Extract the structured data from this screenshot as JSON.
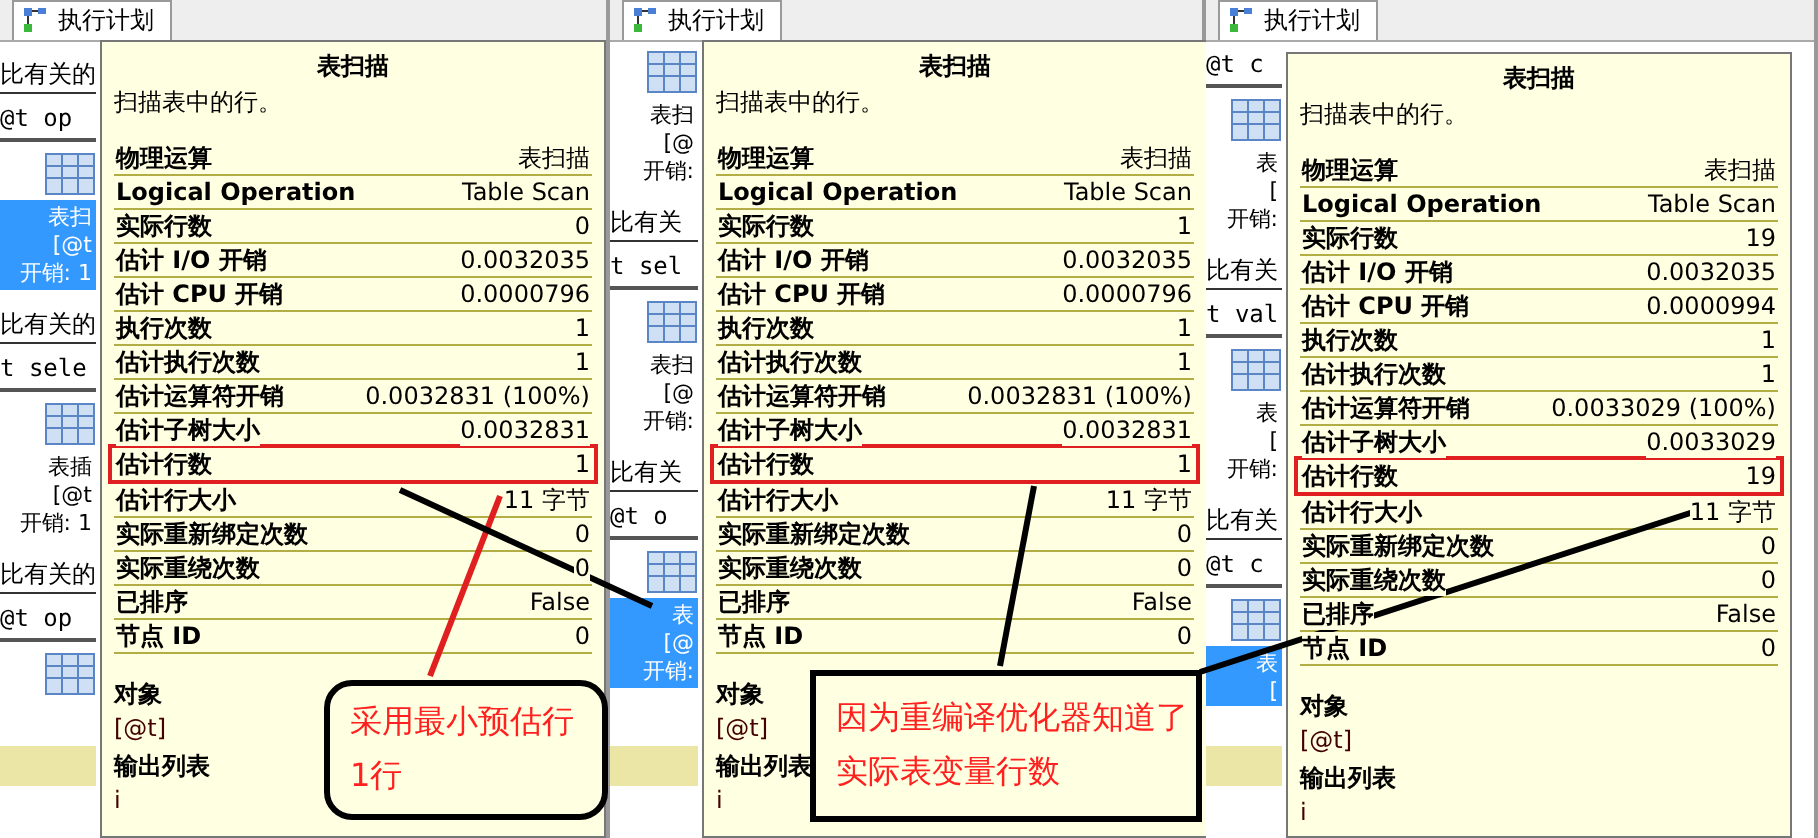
{
  "panels": [
    {
      "tab": "执行计划",
      "background": [
        {
          "kind": "text",
          "text": "比有关的"
        },
        {
          "kind": "code",
          "text": "@t op"
        },
        {
          "kind": "node",
          "selected": true,
          "lines": [
            "表扫",
            "[@t",
            "开销: 1"
          ]
        },
        {
          "kind": "text",
          "text": "比有关的"
        },
        {
          "kind": "code",
          "text": "t sele"
        },
        {
          "kind": "node",
          "selected": false,
          "lines": [
            "表插",
            "[@t",
            "开销: 1"
          ]
        },
        {
          "kind": "text",
          "text": "比有关的"
        },
        {
          "kind": "code",
          "text": "@t op"
        },
        {
          "kind": "node"
        },
        {
          "kind": "bar"
        }
      ],
      "tooltip": {
        "title": "表扫描",
        "description": "扫描表中的行。",
        "rows": [
          {
            "label": "物理运算",
            "value": "表扫描",
            "highlighted": false
          },
          {
            "label": "Logical Operation",
            "value": "Table Scan",
            "highlighted": false
          },
          {
            "label": "实际行数",
            "value": "0",
            "highlighted": false
          },
          {
            "label": "估计 I/O 开销",
            "value": "0.0032035",
            "highlighted": false
          },
          {
            "label": "估计 CPU 开销",
            "value": "0.0000796",
            "highlighted": false
          },
          {
            "label": "执行次数",
            "value": "1",
            "highlighted": false
          },
          {
            "label": "估计执行次数",
            "value": "1",
            "highlighted": false
          },
          {
            "label": "估计运算符开销",
            "value": "0.0032831 (100%)",
            "highlighted": false
          },
          {
            "label": "估计子树大小",
            "value": "0.0032831",
            "highlighted": false
          },
          {
            "label": "估计行数",
            "value": "1",
            "highlighted": true
          },
          {
            "label": "估计行大小",
            "value": "11 字节",
            "highlighted": false
          },
          {
            "label": "实际重新绑定次数",
            "value": "0",
            "highlighted": false
          },
          {
            "label": "实际重绕次数",
            "value": "0",
            "highlighted": false
          },
          {
            "label": "已排序",
            "value": "False",
            "highlighted": false
          },
          {
            "label": "节点 ID",
            "value": "0",
            "highlighted": false
          }
        ],
        "sections": [
          {
            "heading": "对象",
            "value": "[@t]"
          },
          {
            "heading": "输出列表",
            "value": "i"
          }
        ]
      }
    },
    {
      "tab": "执行计划",
      "background": [
        {
          "kind": "node",
          "selected": false,
          "lines": [
            "表扫",
            "[@",
            "开销:"
          ]
        },
        {
          "kind": "text",
          "text": "比有关"
        },
        {
          "kind": "code",
          "text": "t sel"
        },
        {
          "kind": "node",
          "selected": false,
          "lines": [
            "表扫",
            "[@",
            "开销:"
          ]
        },
        {
          "kind": "text",
          "text": "比有关"
        },
        {
          "kind": "code",
          "text": "@t o"
        },
        {
          "kind": "node",
          "selected": true,
          "lines": [
            "表",
            "[@",
            "开销:"
          ]
        },
        {
          "kind": "bar"
        }
      ],
      "tooltip": {
        "title": "表扫描",
        "description": "扫描表中的行。",
        "rows": [
          {
            "label": "物理运算",
            "value": "表扫描",
            "highlighted": false
          },
          {
            "label": "Logical Operation",
            "value": "Table Scan",
            "highlighted": false
          },
          {
            "label": "实际行数",
            "value": "1",
            "highlighted": false
          },
          {
            "label": "估计 I/O 开销",
            "value": "0.0032035",
            "highlighted": false
          },
          {
            "label": "估计 CPU 开销",
            "value": "0.0000796",
            "highlighted": false
          },
          {
            "label": "执行次数",
            "value": "1",
            "highlighted": false
          },
          {
            "label": "估计执行次数",
            "value": "1",
            "highlighted": false
          },
          {
            "label": "估计运算符开销",
            "value": "0.0032831 (100%)",
            "highlighted": false
          },
          {
            "label": "估计子树大小",
            "value": "0.0032831",
            "highlighted": false
          },
          {
            "label": "估计行数",
            "value": "1",
            "highlighted": true
          },
          {
            "label": "估计行大小",
            "value": "11 字节",
            "highlighted": false
          },
          {
            "label": "实际重新绑定次数",
            "value": "0",
            "highlighted": false
          },
          {
            "label": "实际重绕次数",
            "value": "0",
            "highlighted": false
          },
          {
            "label": "已排序",
            "value": "False",
            "highlighted": false
          },
          {
            "label": "节点 ID",
            "value": "0",
            "highlighted": false
          }
        ],
        "sections": [
          {
            "heading": "对象",
            "value": "[@t]"
          },
          {
            "heading": "输出列表",
            "value": "i"
          }
        ]
      }
    },
    {
      "tab": "执行计划",
      "background": [
        {
          "kind": "code",
          "text": "@t c"
        },
        {
          "kind": "node",
          "selected": false,
          "lines": [
            "表",
            "[",
            "开销:"
          ]
        },
        {
          "kind": "text",
          "text": "比有关"
        },
        {
          "kind": "code",
          "text": "t val"
        },
        {
          "kind": "node",
          "selected": false,
          "lines": [
            "表",
            "[",
            "开销:"
          ]
        },
        {
          "kind": "text",
          "text": "比有关"
        },
        {
          "kind": "code",
          "text": "@t c"
        },
        {
          "kind": "node",
          "selected": true,
          "lines": [
            "表",
            "["
          ]
        },
        {
          "kind": "bar"
        }
      ],
      "tooltip": {
        "title": "表扫描",
        "description": "扫描表中的行。",
        "rows": [
          {
            "label": "物理运算",
            "value": "表扫描",
            "highlighted": false
          },
          {
            "label": "Logical Operation",
            "value": "Table Scan",
            "highlighted": false
          },
          {
            "label": "实际行数",
            "value": "19",
            "highlighted": false
          },
          {
            "label": "估计 I/O 开销",
            "value": "0.0032035",
            "highlighted": false
          },
          {
            "label": "估计 CPU 开销",
            "value": "0.0000994",
            "highlighted": false
          },
          {
            "label": "执行次数",
            "value": "1",
            "highlighted": false
          },
          {
            "label": "估计执行次数",
            "value": "1",
            "highlighted": false
          },
          {
            "label": "估计运算符开销",
            "value": "0.0033029 (100%)",
            "highlighted": false
          },
          {
            "label": "估计子树大小",
            "value": "0.0033029",
            "highlighted": false
          },
          {
            "label": "估计行数",
            "value": "19",
            "highlighted": true
          },
          {
            "label": "估计行大小",
            "value": "11 字节",
            "highlighted": false
          },
          {
            "label": "实际重新绑定次数",
            "value": "0",
            "highlighted": false
          },
          {
            "label": "实际重绕次数",
            "value": "0",
            "highlighted": false
          },
          {
            "label": "已排序",
            "value": "False",
            "highlighted": false
          },
          {
            "label": "节点 ID",
            "value": "0",
            "highlighted": false
          }
        ],
        "sections": [
          {
            "heading": "对象",
            "value": "[@t]"
          },
          {
            "heading": "输出列表",
            "value": "i"
          }
        ]
      }
    }
  ],
  "callouts": [
    {
      "kind": "rounded",
      "lines": [
        "采用最小预估行",
        "1行"
      ]
    },
    {
      "kind": "square",
      "lines": [
        "因为重编译优化器知道了",
        "实际表变量行数"
      ]
    }
  ]
}
